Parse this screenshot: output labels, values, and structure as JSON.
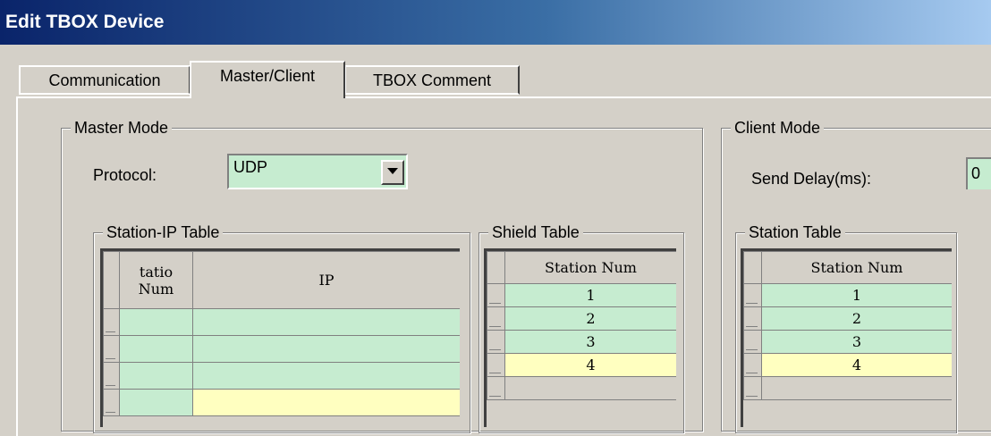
{
  "window": {
    "title": "Edit TBOX Device"
  },
  "tabs": [
    {
      "label": "Communication",
      "active": false
    },
    {
      "label": "Master/Client",
      "active": true
    },
    {
      "label": "TBOX Comment",
      "active": false
    }
  ],
  "master": {
    "group_label": "Master Mode",
    "protocol_label": "Protocol:",
    "protocol_value": "UDP",
    "station_ip_table": {
      "label": "Station-IP Table",
      "headers": [
        "tatio\nNum",
        "IP"
      ],
      "rows": [
        {
          "station": "",
          "ip": "",
          "highlight": false
        },
        {
          "station": "",
          "ip": "",
          "highlight": false
        },
        {
          "station": "",
          "ip": "",
          "highlight": false
        },
        {
          "station": "",
          "ip": "",
          "highlight": true
        }
      ]
    },
    "shield_table": {
      "label": "Shield Table",
      "header": "Station Num",
      "rows": [
        {
          "value": "1",
          "highlight": false
        },
        {
          "value": "2",
          "highlight": false
        },
        {
          "value": "3",
          "highlight": false
        },
        {
          "value": "4",
          "highlight": true
        },
        {
          "value": "",
          "highlight": false
        }
      ]
    }
  },
  "client": {
    "group_label": "Client Mode",
    "send_delay_label": "Send Delay(ms):",
    "send_delay_value": "0",
    "station_table": {
      "label": "Station Table",
      "header": "Station Num",
      "rows": [
        {
          "value": "1",
          "highlight": false
        },
        {
          "value": "2",
          "highlight": false
        },
        {
          "value": "3",
          "highlight": false
        },
        {
          "value": "4",
          "highlight": true
        },
        {
          "value": "",
          "highlight": false
        }
      ]
    }
  },
  "colors": {
    "cell_green": "#c6ecd0",
    "cell_yellow": "#ffffc0",
    "dialog_face": "#d4d0c8",
    "title_start": "#0a246a",
    "title_end": "#a6caf0"
  }
}
